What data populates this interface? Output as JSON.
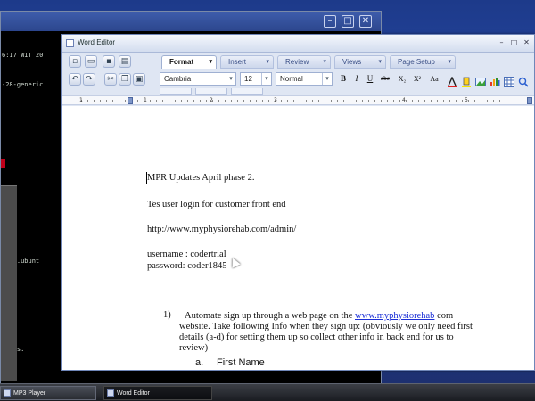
{
  "terminal": {
    "lines": [
      "6:17 WIT 20",
      "-28-generic",
      "",
      "",
      "",
      "",
      "",
      "help.ubunt",
      "",
      ".",
      "dates.",
      "",
      ""
    ]
  },
  "editor": {
    "title": "Word Editor",
    "tabs": [
      {
        "label": "Format",
        "active": true
      },
      {
        "label": "Insert",
        "active": false
      },
      {
        "label": "Review",
        "active": false
      },
      {
        "label": "Views",
        "active": false
      },
      {
        "label": "Page Setup",
        "active": false
      }
    ],
    "font_family": "Cambria",
    "font_size": "12",
    "style": "Normal",
    "format_buttons": [
      "B",
      "I",
      "U",
      "abc",
      "X₂",
      "X²",
      "Aa"
    ],
    "ruler_numbers": [
      "1",
      "1",
      "2",
      "3",
      "4",
      "5"
    ]
  },
  "document": {
    "heading": "MPR Updates April phase 2.",
    "line1": "Tes user login for customer front end",
    "url": "http://www.myphysiorehab.com/admin/",
    "username": "username : codertrial",
    "password": "password: coder1845",
    "item1_number": "1)",
    "item1_text_a": "Automate sign up through a web page on the ",
    "item1_link": "www.myphysiorehab",
    "item1_text_b": " com",
    "item1_line2": "website. Take following Info when they sign up: (obviously we only need first",
    "item1_line3": "details (a-d) for setting them up so collect other info in back end for us to",
    "item1_line4": "review)",
    "subitem_a_marker": "a.",
    "subitem_a_text": "First Name"
  },
  "taskbar": {
    "items": [
      {
        "label": "MP3 Player",
        "active": false
      },
      {
        "label": "Word Editor",
        "active": true
      }
    ]
  }
}
